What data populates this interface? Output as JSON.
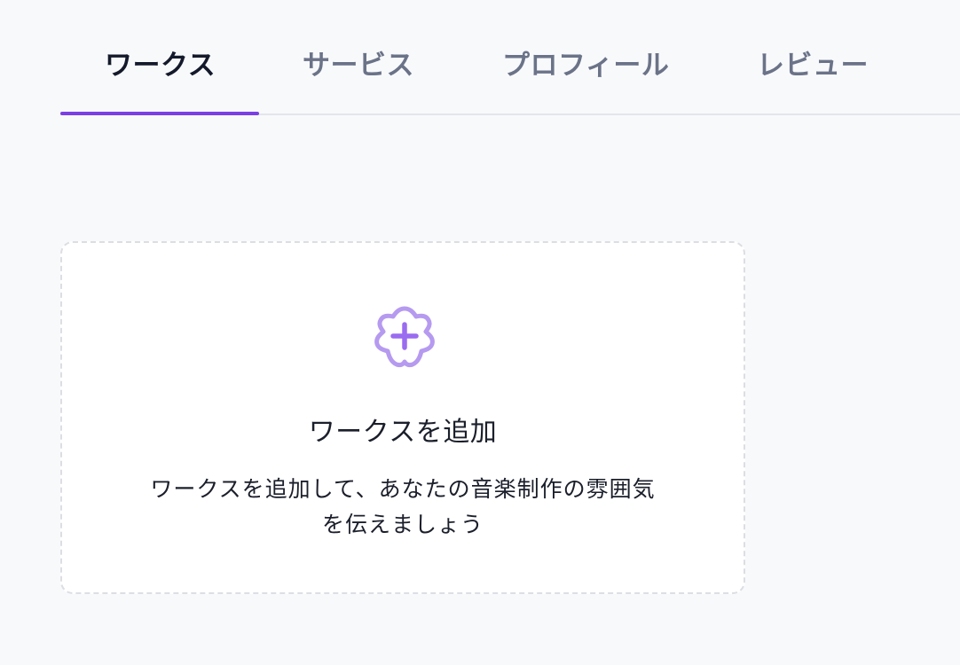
{
  "tabs": [
    {
      "label": "ワークス",
      "active": true
    },
    {
      "label": "サービス",
      "active": false
    },
    {
      "label": "プロフィール",
      "active": false
    },
    {
      "label": "レビュー",
      "active": false
    }
  ],
  "add_card": {
    "icon": "add-circle-icon",
    "title": "ワークスを追加",
    "description_line1": "ワークスを追加して、あなたの音楽制作の雰囲気",
    "description_line2": "を伝えましょう"
  },
  "colors": {
    "accent": "#7b3fe4",
    "icon": "#b69af0",
    "tab_active": "#141a2b",
    "tab_inactive": "#6b7388",
    "background": "#f8f9fb"
  }
}
